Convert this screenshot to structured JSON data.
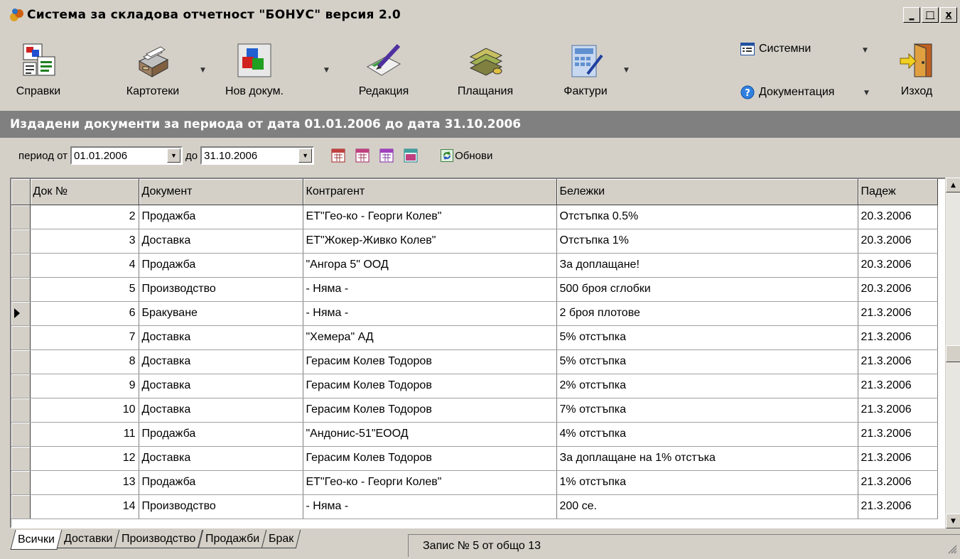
{
  "window": {
    "title": "Система за складова отчетност \"БОНУС\" версия 2.0",
    "min_glyph": "_",
    "max_glyph": "□",
    "close_glyph": "x"
  },
  "toolbar": {
    "spravki": "Справки",
    "kartoteki": "Картотеки",
    "nov_dokum": "Нов докум.",
    "redakcia": "Редакция",
    "plashtania": "Плащания",
    "fakturi": "Фактури",
    "sistemni": "Системни",
    "dokumentacia": "Документация",
    "izhod": "Изход"
  },
  "header": {
    "period_title": "Издадени документи за периода от дата 01.01.2006 до дата 31.10.2006"
  },
  "filter": {
    "from_label": "период от",
    "from_value": "01.01.2006",
    "to_label": "до",
    "to_value": "31.10.2006",
    "refresh_label": "Обнови"
  },
  "grid": {
    "columns": [
      "Док №",
      "Документ",
      "Контрагент",
      "Бележки",
      "Падеж"
    ],
    "rows": [
      {
        "num": "2",
        "doc": "Продажба",
        "party": "ЕТ\"Гео-ко - Георги Колев\"",
        "note": "Отстъпка 0.5%",
        "due": "20.3.2006"
      },
      {
        "num": "3",
        "doc": "Доставка",
        "party": "ЕТ\"Жокер-Живко Колев\"",
        "note": "Отстъпка 1%",
        "due": "20.3.2006"
      },
      {
        "num": "4",
        "doc": "Продажба",
        "party": "\"Ангора 5\" ООД",
        "note": "За доплащане!",
        "due": "20.3.2006"
      },
      {
        "num": "5",
        "doc": "Производство",
        "party": "- Няма -",
        "note": "500 броя сглобки",
        "due": "20.3.2006"
      },
      {
        "num": "6",
        "doc": "Бракуване",
        "party": "- Няма -",
        "note": "2 броя плотове",
        "due": "21.3.2006"
      },
      {
        "num": "7",
        "doc": "Доставка",
        "party": "\"Хемера\" АД",
        "note": "5% отстъпка",
        "due": "21.3.2006"
      },
      {
        "num": "8",
        "doc": "Доставка",
        "party": "Герасим Колев Тодоров",
        "note": "5% отстъпка",
        "due": "21.3.2006"
      },
      {
        "num": "9",
        "doc": "Доставка",
        "party": "Герасим Колев Тодоров",
        "note": "2% отстъпка",
        "due": "21.3.2006"
      },
      {
        "num": "10",
        "doc": "Доставка",
        "party": "Герасим Колев Тодоров",
        "note": "7% отстъпка",
        "due": "21.3.2006"
      },
      {
        "num": "11",
        "doc": "Продажба",
        "party": "\"Андонис-51\"ЕООД",
        "note": "4% отстъпка",
        "due": "21.3.2006"
      },
      {
        "num": "12",
        "doc": "Доставка",
        "party": "Герасим Колев Тодоров",
        "note": "За доплащане на 1% отстъка",
        "due": "21.3.2006"
      },
      {
        "num": "13",
        "doc": "Продажба",
        "party": "ЕТ\"Гео-ко - Георги Колев\"",
        "note": "1% отстъпка",
        "due": "21.3.2006"
      },
      {
        "num": "14",
        "doc": "Производство",
        "party": "- Няма -",
        "note": "200 се.",
        "due": "21.3.2006"
      }
    ],
    "current_row": 4
  },
  "tabs": [
    "Всички",
    "Доставки",
    "Производство",
    "Продажби",
    "Брак"
  ],
  "status": {
    "record_text": "Запис № 5 от общо 13"
  }
}
